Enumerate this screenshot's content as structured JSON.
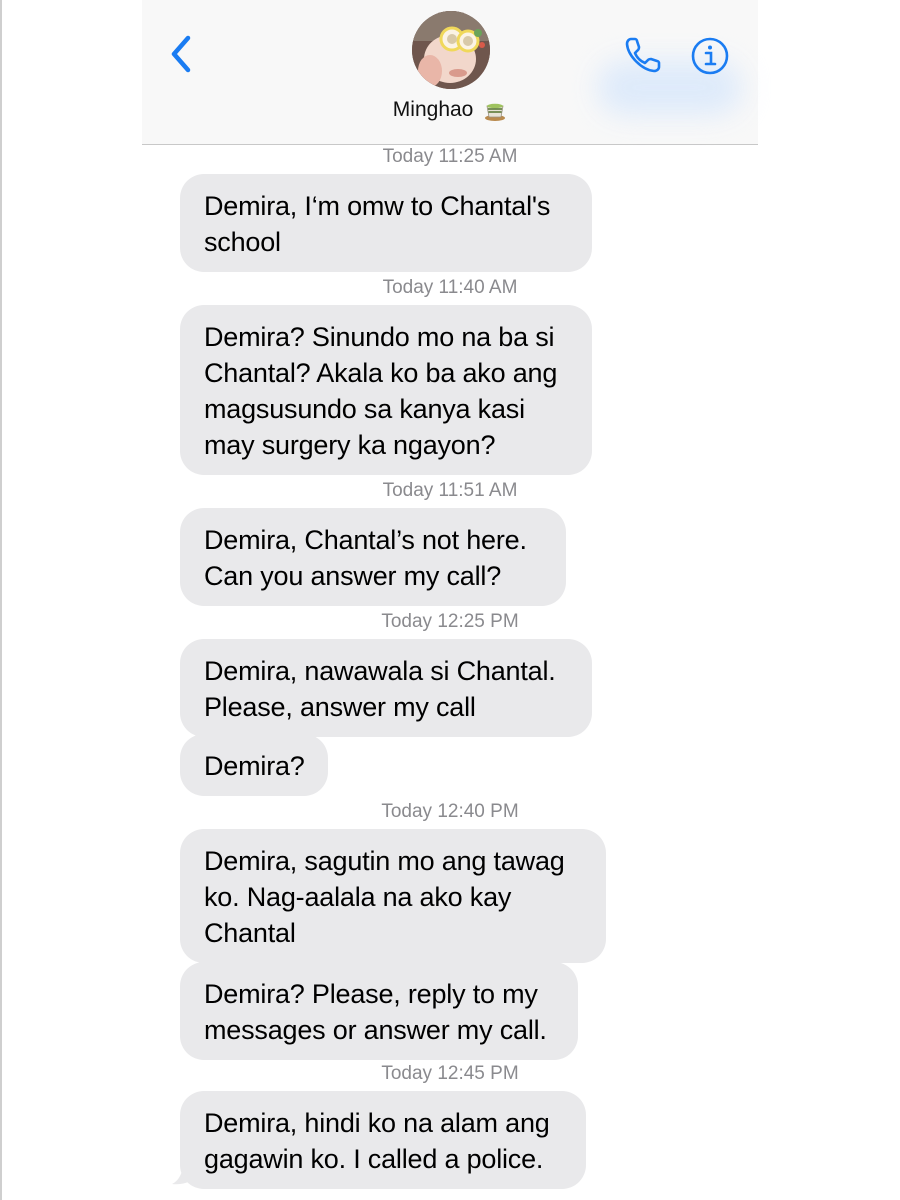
{
  "header": {
    "contact_name": "Minghao",
    "back_icon": "chevron-left-icon",
    "call_icon": "phone-icon",
    "info_icon": "info-icon",
    "accent_color": "#1a7cf2"
  },
  "thread": {
    "bubble_color": "#e9e9eb",
    "timestamps": [
      "Today 11:25 AM",
      "Today 11:40 AM",
      "Today 11:51 AM",
      "Today 12:25 PM",
      "Today 12:40 PM",
      "Today 12:45 PM"
    ],
    "messages": [
      "Demira, I‘m omw to Chantal's\nschool",
      "Demira? Sinundo mo na ba si\nChantal? Akala ko ba ako ang\nmagsusundo sa kanya kasi\nmay surgery ka ngayon?",
      "Demira, Chantal’s not here.\nCan you answer my call?",
      "Demira, nawawala si Chantal.\nPlease, answer my call",
      "Demira?",
      "Demira, sagutin mo ang tawag\nko. Nag-aalala na ako kay\nChantal",
      "Demira? Please, reply to my\nmessages or answer my call.",
      "Demira, hindi ko na alam ang\ngagawin ko. I called a police."
    ]
  }
}
